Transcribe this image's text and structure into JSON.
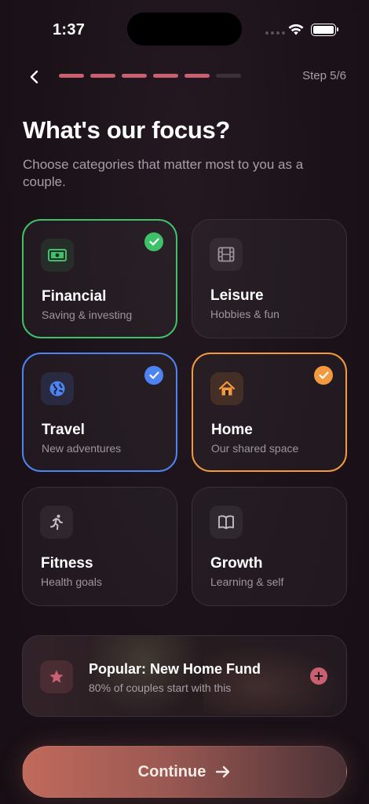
{
  "status_bar": {
    "time": "1:37"
  },
  "nav": {
    "step_label": "Step 5/6",
    "progress_total": 6,
    "progress_done": 5
  },
  "header": {
    "title": "What's our focus?",
    "subtitle": "Choose categories that matter most to you as a couple."
  },
  "categories": [
    {
      "name": "Financial",
      "desc": "Saving & investing",
      "icon": "money-icon",
      "selected": true,
      "color": "#3fc16a"
    },
    {
      "name": "Leisure",
      "desc": "Hobbies & fun",
      "icon": "film-icon",
      "selected": false,
      "color": "#8a8289"
    },
    {
      "name": "Travel",
      "desc": "New adventures",
      "icon": "globe-icon",
      "selected": true,
      "color": "#4e83f2"
    },
    {
      "name": "Home",
      "desc": "Our shared space",
      "icon": "house-icon",
      "selected": true,
      "color": "#f29a3d"
    },
    {
      "name": "Fitness",
      "desc": "Health goals",
      "icon": "running-icon",
      "selected": false,
      "color": "#8a8289"
    },
    {
      "name": "Growth",
      "desc": "Learning & self",
      "icon": "book-icon",
      "selected": false,
      "color": "#8a8289"
    }
  ],
  "popular": {
    "title": "Popular: New Home Fund",
    "subtitle": "80% of couples start with this",
    "accent": "#c9606f"
  },
  "cta": {
    "label": "Continue"
  }
}
